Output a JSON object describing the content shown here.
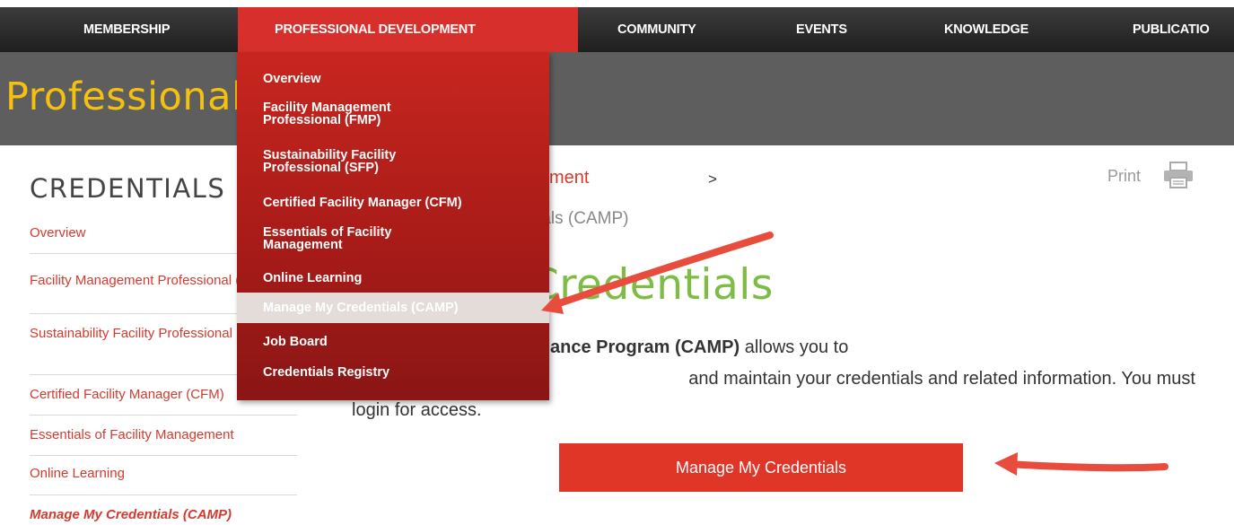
{
  "nav": {
    "items": [
      "MEMBERSHIP",
      "PROFESSIONAL DEVELOPMENT",
      "COMMUNITY",
      "EVENTS",
      "KNOWLEDGE",
      "PUBLICATIO"
    ],
    "active": "PROFESSIONAL DEVELOPMENT"
  },
  "banner": {
    "title": "Professional Development"
  },
  "dropdown": {
    "items": [
      "Overview",
      "Facility Management Professional (FMP)",
      "Sustainability Facility Professional (SFP)",
      "Certified Facility Manager (CFM)",
      "Essentials of Facility Management",
      "Online Learning",
      "Manage My Credentials (CAMP)",
      "Job Board",
      "Credentials Registry"
    ],
    "highlighted": "Manage My Credentials (CAMP)"
  },
  "sidebar": {
    "heading": "CREDENTIALS",
    "items": [
      "Overview",
      "Facility Management Professional (FMP)",
      "Sustainability Facility Professional (SFP)",
      "Certified Facility Manager (CFM)",
      "Essentials of Facility Management",
      "Online Learning",
      "Manage My Credentials (CAMP)"
    ],
    "current": "Manage My Credentials (CAMP)"
  },
  "breadcrumb": {
    "link": "Professional Development",
    "separator": ">",
    "current": "Manage My Credentials (CAMP)"
  },
  "print": {
    "label": "Print"
  },
  "main": {
    "title": "Manage My Credentials",
    "intro_bold": "Application/Maintenance Program (CAMP)",
    "intro_line1_rest": "allows you to",
    "intro_line2": "and maintain your credentials and related information. You must",
    "intro_line3": "login for access."
  },
  "cta": {
    "label": "Manage My Credentials"
  },
  "colors": {
    "accent": "#d23b2f",
    "nav_active": "#d7302c",
    "banner_bg": "#5e5e5e",
    "banner_title": "#f4c10f",
    "page_title": "#7fbc45",
    "cta_bg": "#e03628",
    "arrow": "#e84c3d"
  },
  "icons": {
    "print": "printer-icon"
  }
}
